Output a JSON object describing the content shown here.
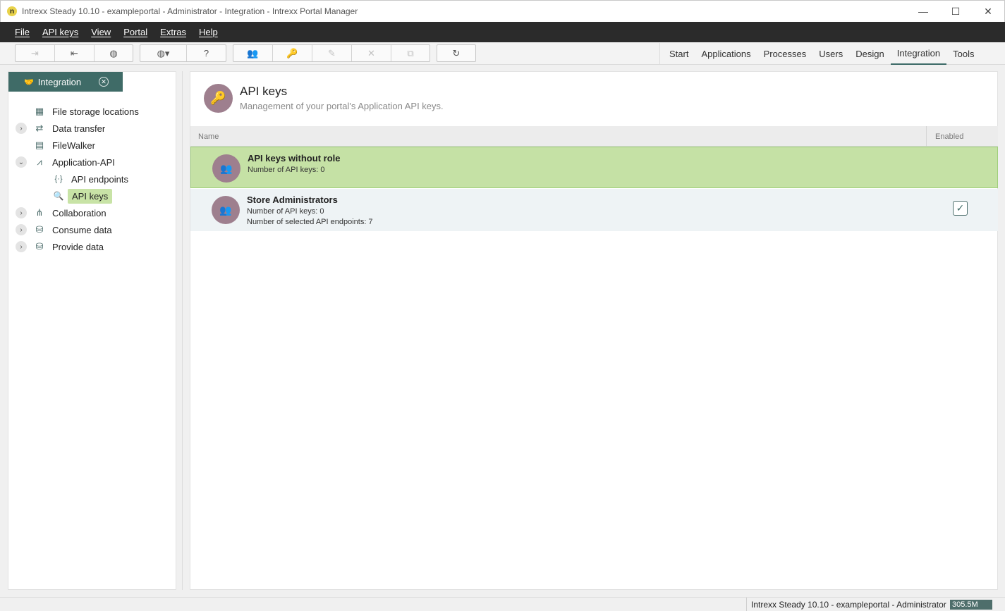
{
  "window": {
    "title": "Intrexx Steady 10.10 - exampleportal - Administrator - Integration - Intrexx Portal Manager",
    "minimize": "—",
    "maximize": "☐",
    "close": "✕"
  },
  "menubar": [
    {
      "label": "File"
    },
    {
      "label": "API keys"
    },
    {
      "label": "View"
    },
    {
      "label": "Portal"
    },
    {
      "label": "Extras"
    },
    {
      "label": "Help"
    }
  ],
  "toolbar": {
    "icons": {
      "login": "⇥",
      "logout": "⇤",
      "globe": "◍",
      "language": "◍▾",
      "help": "?",
      "roles": "👥",
      "key": "🔑",
      "edit": "✎",
      "delete": "✕",
      "copy": "⧉",
      "refresh": "↻"
    }
  },
  "nav_tabs": [
    {
      "label": "Start",
      "active": false
    },
    {
      "label": "Applications",
      "active": false
    },
    {
      "label": "Processes",
      "active": false
    },
    {
      "label": "Users",
      "active": false
    },
    {
      "label": "Design",
      "active": false
    },
    {
      "label": "Integration",
      "active": true
    },
    {
      "label": "Tools",
      "active": false
    }
  ],
  "left_panel": {
    "tab_label": "Integration",
    "tab_icon": "🤝",
    "tree": [
      {
        "label": "File storage locations",
        "icon": "▦"
      },
      {
        "label": "Data transfer",
        "icon": "⇄",
        "expander": "›"
      },
      {
        "label": "FileWalker",
        "icon": "▤"
      },
      {
        "label": "Application-API",
        "icon": "⩘",
        "expander": "⌄"
      },
      {
        "label": "API endpoints",
        "icon": "{·}"
      },
      {
        "label": "API keys",
        "icon": "🔍"
      },
      {
        "label": "Collaboration",
        "icon": "⋔",
        "expander": "›"
      },
      {
        "label": "Consume data",
        "icon": "⛁",
        "expander": "›"
      },
      {
        "label": "Provide data",
        "icon": "⛁",
        "expander": "›"
      }
    ]
  },
  "main": {
    "title": "API keys",
    "subtitle": "Management of your portal's Application API keys.",
    "header_icon": "🔑",
    "columns": {
      "name": "Name",
      "enabled": "Enabled"
    },
    "rows": [
      {
        "title": "API keys without role",
        "line1": "Number of API keys: 0",
        "line2": "",
        "enabled": false,
        "selected": true
      },
      {
        "title": "Store Administrators",
        "line1": "Number of API keys: 0",
        "line2": "Number of selected API endpoints: 7",
        "enabled": true,
        "selected": false
      }
    ],
    "row_icon": "👥",
    "check_glyph": "✓"
  },
  "statusbar": {
    "text": "Intrexx Steady 10.10 - exampleportal - Administrator",
    "memory": "305.5M"
  }
}
